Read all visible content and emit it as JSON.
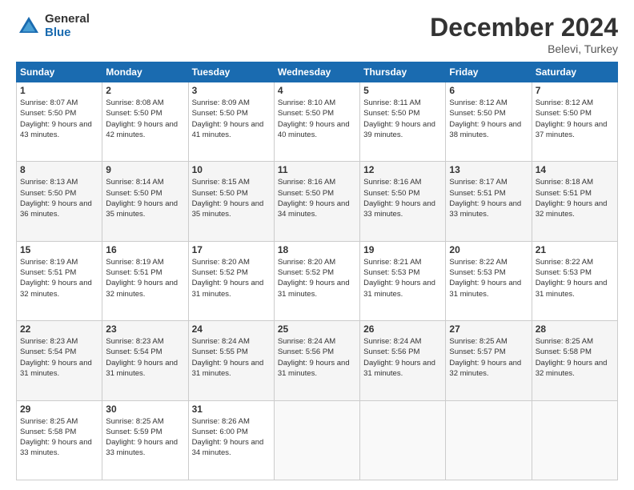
{
  "logo": {
    "general": "General",
    "blue": "Blue"
  },
  "header": {
    "title": "December 2024",
    "location": "Belevi, Turkey"
  },
  "weekdays": [
    "Sunday",
    "Monday",
    "Tuesday",
    "Wednesday",
    "Thursday",
    "Friday",
    "Saturday"
  ],
  "weeks": [
    [
      {
        "day": "1",
        "sunrise": "8:07 AM",
        "sunset": "5:50 PM",
        "daylight": "9 hours and 43 minutes."
      },
      {
        "day": "2",
        "sunrise": "8:08 AM",
        "sunset": "5:50 PM",
        "daylight": "9 hours and 42 minutes."
      },
      {
        "day": "3",
        "sunrise": "8:09 AM",
        "sunset": "5:50 PM",
        "daylight": "9 hours and 41 minutes."
      },
      {
        "day": "4",
        "sunrise": "8:10 AM",
        "sunset": "5:50 PM",
        "daylight": "9 hours and 40 minutes."
      },
      {
        "day": "5",
        "sunrise": "8:11 AM",
        "sunset": "5:50 PM",
        "daylight": "9 hours and 39 minutes."
      },
      {
        "day": "6",
        "sunrise": "8:12 AM",
        "sunset": "5:50 PM",
        "daylight": "9 hours and 38 minutes."
      },
      {
        "day": "7",
        "sunrise": "8:12 AM",
        "sunset": "5:50 PM",
        "daylight": "9 hours and 37 minutes."
      }
    ],
    [
      {
        "day": "8",
        "sunrise": "8:13 AM",
        "sunset": "5:50 PM",
        "daylight": "9 hours and 36 minutes."
      },
      {
        "day": "9",
        "sunrise": "8:14 AM",
        "sunset": "5:50 PM",
        "daylight": "9 hours and 35 minutes."
      },
      {
        "day": "10",
        "sunrise": "8:15 AM",
        "sunset": "5:50 PM",
        "daylight": "9 hours and 35 minutes."
      },
      {
        "day": "11",
        "sunrise": "8:16 AM",
        "sunset": "5:50 PM",
        "daylight": "9 hours and 34 minutes."
      },
      {
        "day": "12",
        "sunrise": "8:16 AM",
        "sunset": "5:50 PM",
        "daylight": "9 hours and 33 minutes."
      },
      {
        "day": "13",
        "sunrise": "8:17 AM",
        "sunset": "5:51 PM",
        "daylight": "9 hours and 33 minutes."
      },
      {
        "day": "14",
        "sunrise": "8:18 AM",
        "sunset": "5:51 PM",
        "daylight": "9 hours and 32 minutes."
      }
    ],
    [
      {
        "day": "15",
        "sunrise": "8:19 AM",
        "sunset": "5:51 PM",
        "daylight": "9 hours and 32 minutes."
      },
      {
        "day": "16",
        "sunrise": "8:19 AM",
        "sunset": "5:51 PM",
        "daylight": "9 hours and 32 minutes."
      },
      {
        "day": "17",
        "sunrise": "8:20 AM",
        "sunset": "5:52 PM",
        "daylight": "9 hours and 31 minutes."
      },
      {
        "day": "18",
        "sunrise": "8:20 AM",
        "sunset": "5:52 PM",
        "daylight": "9 hours and 31 minutes."
      },
      {
        "day": "19",
        "sunrise": "8:21 AM",
        "sunset": "5:53 PM",
        "daylight": "9 hours and 31 minutes."
      },
      {
        "day": "20",
        "sunrise": "8:22 AM",
        "sunset": "5:53 PM",
        "daylight": "9 hours and 31 minutes."
      },
      {
        "day": "21",
        "sunrise": "8:22 AM",
        "sunset": "5:53 PM",
        "daylight": "9 hours and 31 minutes."
      }
    ],
    [
      {
        "day": "22",
        "sunrise": "8:23 AM",
        "sunset": "5:54 PM",
        "daylight": "9 hours and 31 minutes."
      },
      {
        "day": "23",
        "sunrise": "8:23 AM",
        "sunset": "5:54 PM",
        "daylight": "9 hours and 31 minutes."
      },
      {
        "day": "24",
        "sunrise": "8:24 AM",
        "sunset": "5:55 PM",
        "daylight": "9 hours and 31 minutes."
      },
      {
        "day": "25",
        "sunrise": "8:24 AM",
        "sunset": "5:56 PM",
        "daylight": "9 hours and 31 minutes."
      },
      {
        "day": "26",
        "sunrise": "8:24 AM",
        "sunset": "5:56 PM",
        "daylight": "9 hours and 31 minutes."
      },
      {
        "day": "27",
        "sunrise": "8:25 AM",
        "sunset": "5:57 PM",
        "daylight": "9 hours and 32 minutes."
      },
      {
        "day": "28",
        "sunrise": "8:25 AM",
        "sunset": "5:58 PM",
        "daylight": "9 hours and 32 minutes."
      }
    ],
    [
      {
        "day": "29",
        "sunrise": "8:25 AM",
        "sunset": "5:58 PM",
        "daylight": "9 hours and 33 minutes."
      },
      {
        "day": "30",
        "sunrise": "8:25 AM",
        "sunset": "5:59 PM",
        "daylight": "9 hours and 33 minutes."
      },
      {
        "day": "31",
        "sunrise": "8:26 AM",
        "sunset": "6:00 PM",
        "daylight": "9 hours and 34 minutes."
      },
      null,
      null,
      null,
      null
    ]
  ]
}
